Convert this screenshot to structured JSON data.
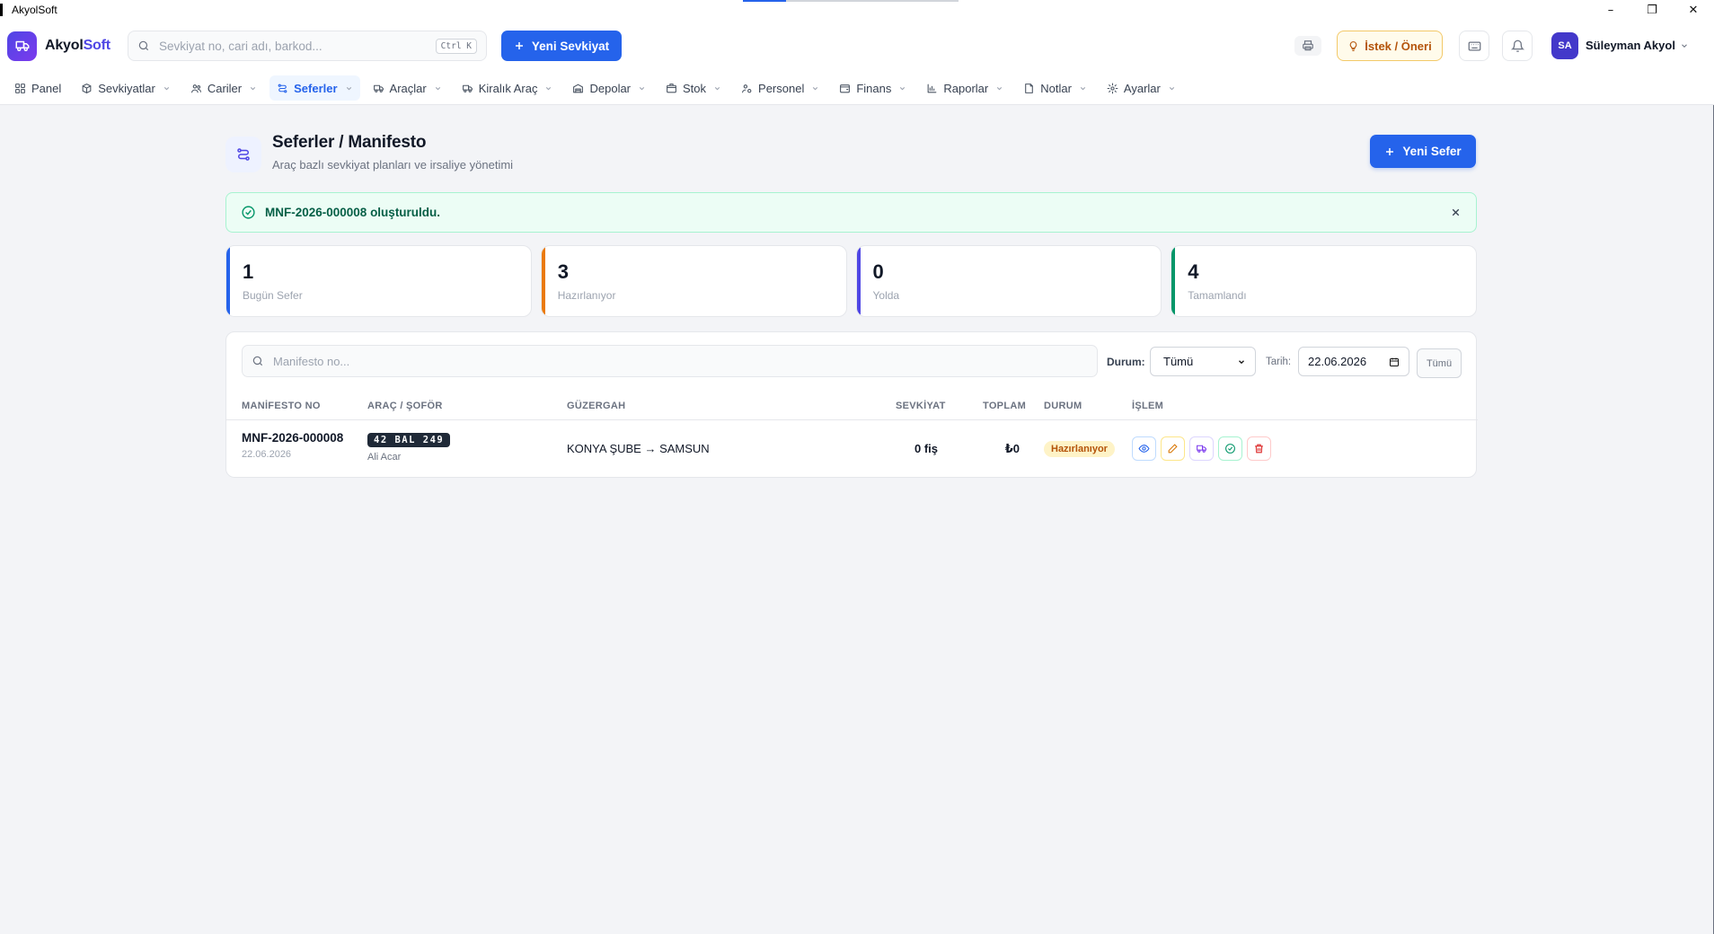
{
  "window": {
    "title": "AkyolSoft",
    "controls": [
      "–",
      "❐",
      "✕"
    ]
  },
  "header": {
    "logo_a": "Akyol",
    "logo_b": "Soft",
    "search_placeholder": "Sevkiyat no, cari adı, barkod...",
    "search_shortcut": "Ctrl K",
    "new_shipment": "Yeni Sevkiyat",
    "suggest": "İstek / Öneri",
    "user_initials": "SA",
    "user_name": "Süleyman Akyol"
  },
  "nav": {
    "items": [
      {
        "label": "Panel",
        "icon": "grid-icon",
        "chevron": false,
        "active": false
      },
      {
        "label": "Sevkiyatlar",
        "icon": "box-icon",
        "chevron": true,
        "active": false
      },
      {
        "label": "Cariler",
        "icon": "users-icon",
        "chevron": true,
        "active": false
      },
      {
        "label": "Seferler",
        "icon": "route-icon",
        "chevron": true,
        "active": true
      },
      {
        "label": "Araçlar",
        "icon": "truck-icon",
        "chevron": true,
        "active": false
      },
      {
        "label": "Kiralık Araç",
        "icon": "truck-icon",
        "chevron": true,
        "active": false
      },
      {
        "label": "Depolar",
        "icon": "warehouse-icon",
        "chevron": true,
        "active": false
      },
      {
        "label": "Stok",
        "icon": "package-icon",
        "chevron": true,
        "active": false
      },
      {
        "label": "Personel",
        "icon": "user-cog-icon",
        "chevron": true,
        "active": false
      },
      {
        "label": "Finans",
        "icon": "wallet-icon",
        "chevron": true,
        "active": false
      },
      {
        "label": "Raporlar",
        "icon": "chart-icon",
        "chevron": true,
        "active": false
      },
      {
        "label": "Notlar",
        "icon": "note-icon",
        "chevron": true,
        "active": false
      },
      {
        "label": "Ayarlar",
        "icon": "gear-icon",
        "chevron": true,
        "active": false
      }
    ]
  },
  "page": {
    "title": "Seferler / Manifesto",
    "subtitle": "Araç bazlı sevkiyat planları ve irsaliye yönetimi",
    "new_trip": "Yeni Sefer"
  },
  "alert": {
    "message": "MNF-2026-000008 oluşturuldu."
  },
  "stats": [
    {
      "value": "1",
      "label": "Bugün Sefer",
      "color": "#2563eb"
    },
    {
      "value": "3",
      "label": "Hazırlanıyor",
      "color": "#ea7a0c"
    },
    {
      "value": "0",
      "label": "Yolda",
      "color": "#4f46e5"
    },
    {
      "value": "4",
      "label": "Tamamlandı",
      "color": "#059669"
    }
  ],
  "filters": {
    "search_placeholder": "Manifesto no...",
    "status_label": "Durum:",
    "status_value": "Tümü",
    "date_label": "Tarih:",
    "date_value": "22.06.2026",
    "all_button": "Tümü"
  },
  "table": {
    "columns": [
      "MANİFESTO NO",
      "ARAÇ / ŞOFÖR",
      "GÜZERGAH",
      "SEVKİYAT",
      "TOPLAM",
      "DURUM",
      "İŞLEM"
    ],
    "rows": [
      {
        "manifest_no": "MNF-2026-000008",
        "date": "22.06.2026",
        "plate": "42 BAL 249",
        "driver": "Ali Acar",
        "route": "KONYA ŞUBE → SAMSUN",
        "shipments": "0 fiş",
        "total": "₺0",
        "status": "Hazırlanıyor"
      }
    ]
  },
  "colors": {
    "primary": "#2563eb",
    "brand": "#4f46e5",
    "success": "#059669",
    "warning": "#b45309"
  }
}
